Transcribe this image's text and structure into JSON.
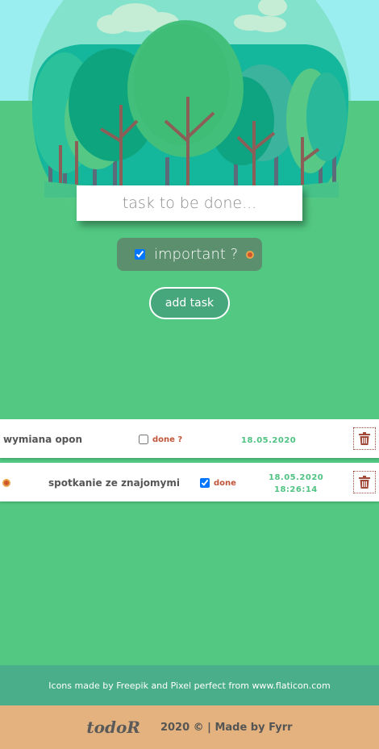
{
  "form": {
    "task_placeholder": "task to be done...",
    "important_label": "important ?",
    "important_checked": true,
    "add_button": "add task"
  },
  "tasks": [
    {
      "name": "wymiana opon",
      "important": false,
      "done": false,
      "done_label": "done ?",
      "date": "18.05.2020",
      "time": ""
    },
    {
      "name": "spotkanie ze znajomymi",
      "important": true,
      "done": true,
      "done_label": "done",
      "date": "18.05.2020",
      "time": "18:26:14"
    }
  ],
  "footer": {
    "credits": "Icons made by Freepik and Pixel perfect from www.flaticon.com",
    "logo": "todoR",
    "copyright": "2020 © | Made by Fyrr"
  },
  "colors": {
    "background": "#52c882",
    "sky": "#9aeef0",
    "accent_green": "#4fc282",
    "done_red": "#c0553a",
    "footer_teal": "#4bae8a",
    "footer_sand": "#e3b27e"
  },
  "icons": {
    "trash": "trash-icon",
    "important": "important-dot-icon"
  }
}
